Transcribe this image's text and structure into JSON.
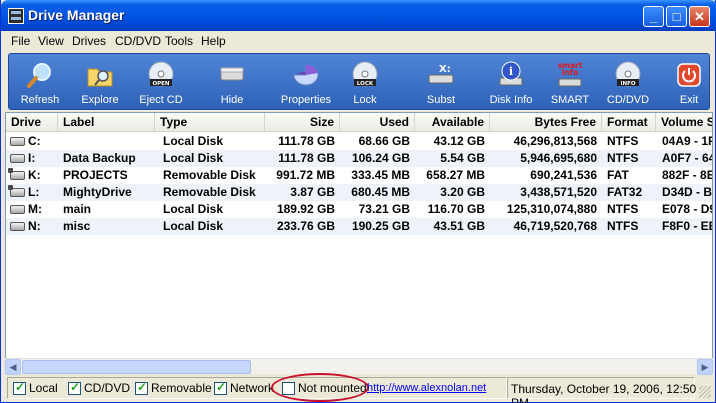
{
  "window": {
    "title": "Drive Manager"
  },
  "menu": [
    "File",
    "View",
    "Drives",
    "CD/DVD",
    "Tools",
    "Help"
  ],
  "toolbar": [
    {
      "label": "Refresh",
      "icon": "magnifier-icon"
    },
    {
      "label": "Explore",
      "icon": "folder-search-icon"
    },
    {
      "label": "Eject CD",
      "icon": "cd-open-icon",
      "badge": "OPEN"
    },
    {
      "label": "Hide",
      "icon": "drive-hide-icon"
    },
    {
      "label": "Properties",
      "icon": "pie-chart-icon"
    },
    {
      "label": "Lock",
      "icon": "cd-lock-icon",
      "badge": "LOCK"
    },
    {
      "label": "Subst",
      "icon": "drive-subst-icon"
    },
    {
      "label": "Disk Info",
      "icon": "info-icon"
    },
    {
      "label": "SMART",
      "icon": "smart-info-icon",
      "badge": "smart info"
    },
    {
      "label": "CD/DVD",
      "icon": "cd-info-icon",
      "badge": "INFO"
    },
    {
      "label": "Exit",
      "icon": "power-icon"
    }
  ],
  "columns": [
    "Drive",
    "Label",
    "Type",
    "Size",
    "Used",
    "Available",
    "Bytes Free",
    "Format",
    "Volume S"
  ],
  "rows": [
    {
      "drive": "C:",
      "label": "",
      "type": "Local Disk",
      "size": "111.78 GB",
      "used": "68.66 GB",
      "available": "43.12 GB",
      "bytes_free": "46,296,813,568",
      "format": "NTFS",
      "volume": "04A9 - 1F",
      "icon": "hdd"
    },
    {
      "drive": "I:",
      "label": "Data Backup",
      "type": "Local Disk",
      "size": "111.78 GB",
      "used": "106.24 GB",
      "available": "5.54 GB",
      "bytes_free": "5,946,695,680",
      "format": "NTFS",
      "volume": "A0F7 - 64",
      "icon": "hdd"
    },
    {
      "drive": "K:",
      "label": "PROJECTS",
      "type": "Removable Disk",
      "size": "991.72 MB",
      "used": "333.45 MB",
      "available": "658.27 MB",
      "bytes_free": "690,241,536",
      "format": "FAT",
      "volume": "882F - 8E",
      "icon": "usb"
    },
    {
      "drive": "L:",
      "label": "MightyDrive",
      "type": "Removable Disk",
      "size": "3.87 GB",
      "used": "680.45 MB",
      "available": "3.20 GB",
      "bytes_free": "3,438,571,520",
      "format": "FAT32",
      "volume": "D34D - B",
      "icon": "usb"
    },
    {
      "drive": "M:",
      "label": "main",
      "type": "Local Disk",
      "size": "189.92 GB",
      "used": "73.21 GB",
      "available": "116.70 GB",
      "bytes_free": "125,310,074,880",
      "format": "NTFS",
      "volume": "E078 - D9",
      "icon": "hdd"
    },
    {
      "drive": "N:",
      "label": "misc",
      "type": "Local Disk",
      "size": "233.76 GB",
      "used": "190.25 GB",
      "available": "43.51 GB",
      "bytes_free": "46,719,520,768",
      "format": "NTFS",
      "volume": "F8F0 - EE",
      "icon": "hdd"
    }
  ],
  "status": {
    "filters": [
      {
        "label": "Local",
        "checked": true
      },
      {
        "label": "CD/DVD",
        "checked": true
      },
      {
        "label": "Removable",
        "checked": true
      },
      {
        "label": "Network",
        "checked": true
      },
      {
        "label": "Not mounted",
        "checked": false
      }
    ],
    "link": "http://www.alexnolan.net",
    "datetime": "Thursday, October 19, 2006, 12:50 PM"
  },
  "colors": {
    "title_bar": "#0055e5",
    "toolbar": "#3a6ec6",
    "highlight_circle": "#c8102e",
    "alt_row": "#eef3fa"
  }
}
